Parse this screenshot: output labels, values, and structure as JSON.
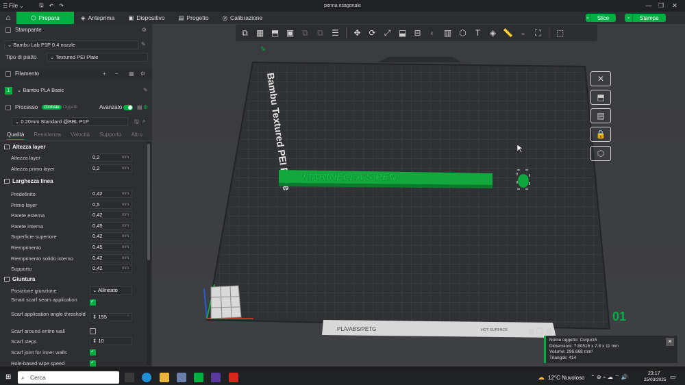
{
  "window": {
    "title": "penna esagonale",
    "file_menu": "File",
    "controls": [
      "—",
      "❐",
      "✕"
    ]
  },
  "nav": {
    "tabs": [
      {
        "label": "Prepara",
        "active": true
      },
      {
        "label": "Anteprima",
        "active": false
      },
      {
        "label": "Dispositivo",
        "active": false
      },
      {
        "label": "Progetto",
        "active": false
      },
      {
        "label": "Calibrazione",
        "active": false
      }
    ],
    "slice_label": "Slice",
    "print_label": "Stampa"
  },
  "printer": {
    "section_title": "Stampante",
    "printer_name": "Bambu Lab P1P 0.4 nozzle",
    "plate_label": "Tipo di piatto",
    "plate_value": "Textured PEI Plate"
  },
  "filament": {
    "section_title": "Filamento",
    "slot": "1",
    "name": "Bambu PLA Basic"
  },
  "process": {
    "section_title": "Processo",
    "toggle_global": "Globale",
    "toggle_objects": "Oggetti",
    "advanced_label": "Avanzato",
    "profile": "0.20mm Standard @BBL P1P",
    "tabs": [
      "Qualità",
      "Resistenza",
      "Velocità",
      "Supporto",
      "Altro"
    ]
  },
  "params": {
    "layer_height": {
      "title": "Altezza layer",
      "rows": [
        {
          "label": "Altezza layer",
          "value": "0,2",
          "unit": "mm"
        },
        {
          "label": "Altezza primo layer",
          "value": "0,2",
          "unit": "mm"
        }
      ]
    },
    "line_width": {
      "title": "Larghezza linea",
      "rows": [
        {
          "label": "Predefinito",
          "value": "0,42",
          "unit": "mm"
        },
        {
          "label": "Primo layer",
          "value": "0,5",
          "unit": "mm"
        },
        {
          "label": "Parete esterna",
          "value": "0,42",
          "unit": "mm"
        },
        {
          "label": "Parete interna",
          "value": "0,45",
          "unit": "mm"
        },
        {
          "label": "Superficie superiore",
          "value": "0,42",
          "unit": "mm"
        },
        {
          "label": "Riempimento",
          "value": "0,45",
          "unit": "mm"
        },
        {
          "label": "Riempimento solido interno",
          "value": "0,42",
          "unit": "mm"
        },
        {
          "label": "Supporto",
          "value": "0,42",
          "unit": "mm"
        }
      ]
    },
    "seam": {
      "title": "Giuntura",
      "position_label": "Posizione giunzione",
      "position_value": "Allineato",
      "smart_scarf_label": "Smart scarf seam application",
      "smart_scarf_checked": true,
      "scarf_angle_label": "Scarf application angle threshold",
      "scarf_angle_value": "155",
      "scarf_around_label": "Scarf around entire wall",
      "scarf_around_checked": false,
      "scarf_steps_label": "Scarf steps",
      "scarf_steps_value": "10",
      "scarf_inner_label": "Scarf joint for inner walls",
      "scarf_inner_checked": true,
      "role_wipe_label": "Role-based wipe speed",
      "role_wipe_checked": true
    }
  },
  "viewport": {
    "plate_name": "Bambu Textured PEI Plate",
    "object_text": "MARINELLA'S PEN",
    "plate_number": "01",
    "plate_material": "PLA/ABS/PETG",
    "plate_surface": "HOT SURFACE"
  },
  "info": {
    "object_name": "Nome oggetto: Corpo16",
    "dimensions": "Dimensioni: 7.80516 x 7.8 x 11 mm",
    "volume": "Volume: 296.668 mm³",
    "triangles": "Triangoli: 414"
  },
  "taskbar": {
    "search": "Cerca",
    "weather": "12°C Nuvoloso",
    "time": "23:17",
    "date": "25/03/2025"
  },
  "colors": {
    "accent": "#00ae42",
    "plate": "#303134",
    "grid": "#46484c"
  }
}
